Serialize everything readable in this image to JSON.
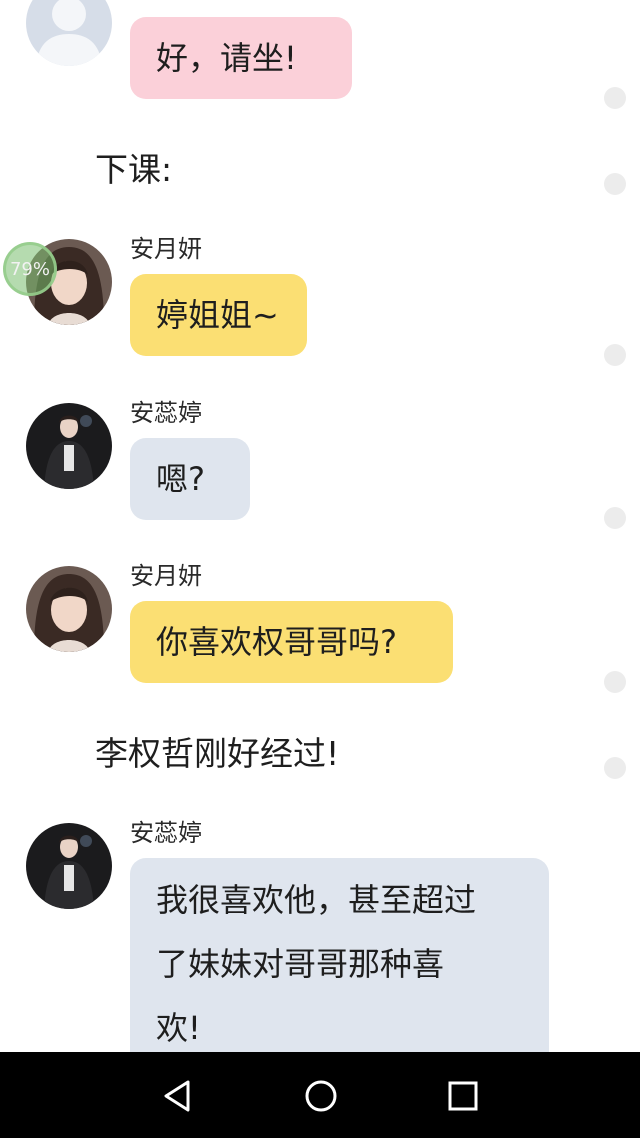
{
  "messages": [
    {
      "type": "bubble",
      "sender": "",
      "text": "好，请坐!",
      "color": "#fbd0d9",
      "avatar": "default-avatar"
    },
    {
      "type": "narration",
      "text": "下课:"
    },
    {
      "type": "bubble",
      "sender": "安月妍",
      "text": "婷姐姐~",
      "color": "#fbdf73",
      "avatar": "yueyan-avatar"
    },
    {
      "type": "bubble",
      "sender": "安蕊婷",
      "text": "嗯?",
      "color": "#dfe5ee",
      "avatar": "ruiting-avatar"
    },
    {
      "type": "bubble",
      "sender": "安月妍",
      "text": "你喜欢权哥哥吗?",
      "color": "#fbdf73",
      "avatar": "yueyan-avatar"
    },
    {
      "type": "narration",
      "text": "李权哲刚好经过!"
    },
    {
      "type": "bubble",
      "sender": "安蕊婷",
      "lines": [
        "我很喜欢他，甚至超过",
        "了妹妹对哥哥那种喜",
        "欢!"
      ],
      "color": "#dfe5ee",
      "avatar": "ruiting-avatar"
    }
  ],
  "overlay": {
    "progress_text": "79%",
    "progress_value": 79
  },
  "navbar": {
    "back_icon": "triangle-back-icon",
    "home_icon": "circle-home-icon",
    "recents_icon": "square-recents-icon"
  }
}
